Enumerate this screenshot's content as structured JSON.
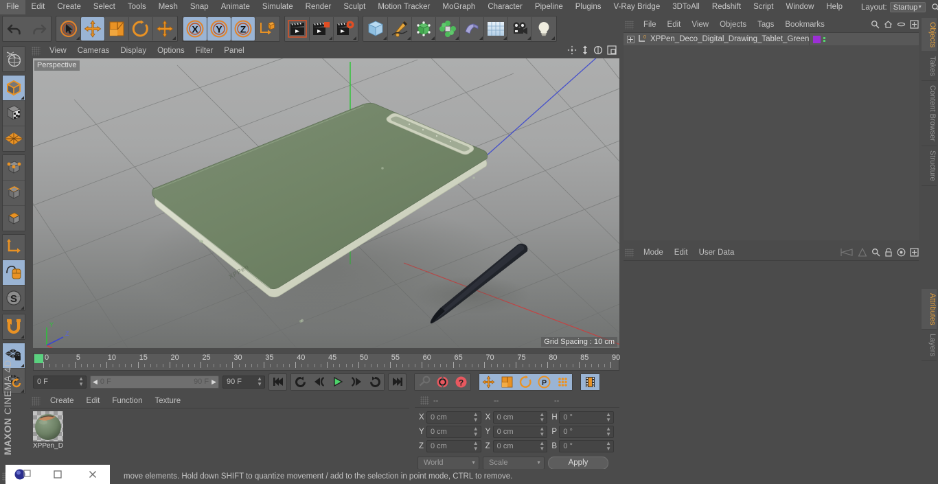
{
  "app": {
    "brand_maxon": "MAXON",
    "brand_c4d": "CINEMA 4D"
  },
  "menubar": {
    "items": [
      "File",
      "Edit",
      "Create",
      "Select",
      "Tools",
      "Mesh",
      "Snap",
      "Animate",
      "Simulate",
      "Render",
      "Sculpt",
      "Motion Tracker",
      "MoGraph",
      "Character",
      "Pipeline",
      "Plugins",
      "V-Ray Bridge",
      "3DToAll",
      "Redshift",
      "Script",
      "Window",
      "Help"
    ],
    "layout_label": "Layout:",
    "layout_value": "Startup"
  },
  "toolbar": {
    "undo": "undo-arrow",
    "redo": "redo-arrow",
    "live_select": "live-selection-tool",
    "move": "move-tool",
    "scale": "scale-tool",
    "rotate": "rotate-tool",
    "move2": "move-tool-2",
    "axis_x": "X",
    "axis_y": "Y",
    "axis_z": "Z",
    "world_object": "world-object-axis",
    "render_view": "render-view",
    "render_region": "render-region",
    "render_settings": "render-settings",
    "cube": "primitive-cube",
    "spline": "spline-pen",
    "nurbs": "subdivision-surface",
    "mograph": "mograph-cloner",
    "deformer": "bend-deformer",
    "scene": "floor-environment",
    "camera": "camera-object",
    "light": "light-object"
  },
  "lefttools": [
    {
      "name": "texture-axis-tool",
      "selected": false
    },
    {
      "name": "model-mode",
      "selected": true
    },
    {
      "name": "texture-mode",
      "selected": false
    },
    {
      "name": "polygon-grid-mode",
      "selected": false
    },
    {
      "name": "points-mode",
      "selected": false
    },
    {
      "name": "edges-mode",
      "selected": false
    },
    {
      "name": "polygons-mode",
      "selected": false
    },
    {
      "name": "object-axis-mode",
      "selected": false
    },
    {
      "name": "enable-axis-mode",
      "selected": true
    },
    {
      "name": "viewport-solo-mode",
      "selected": false
    },
    {
      "name": "enable-snapping",
      "selected": false
    },
    {
      "name": "lock-workplane",
      "selected": true
    },
    {
      "name": "workplane-mode",
      "selected": false
    }
  ],
  "viewport": {
    "menu": [
      "View",
      "Cameras",
      "Display",
      "Options",
      "Filter",
      "Panel"
    ],
    "label": "Perspective",
    "grid_spacing": "Grid Spacing : 10 cm",
    "axis_x": "X",
    "axis_y": "Y",
    "axis_z": "Z",
    "corner_icons": [
      "pan-icon",
      "dolly-icon",
      "rotate-view-icon",
      "maximize-viewport-icon"
    ],
    "colors": {
      "tablet_body": "#6f8268",
      "tablet_edge": "#d8dccb",
      "stylus": "#23262d",
      "axis_x": "#d84a4a",
      "axis_y": "#3fc64a",
      "axis_z": "#4a55d8",
      "bg_top": "#a9aaa9",
      "bg_bottom": "#6e706e"
    }
  },
  "timeline": {
    "ticks": [
      0,
      5,
      10,
      15,
      20,
      25,
      30,
      35,
      40,
      45,
      50,
      55,
      60,
      65,
      70,
      75,
      80,
      85,
      90
    ],
    "current_frame": "0 F",
    "range_start": "0 F",
    "range_end": "90 F",
    "max_frame": "90 F",
    "preview_end": "0 F",
    "buttons": [
      "go-to-start",
      "play-backwards-loop",
      "step-back",
      "play",
      "step-forward",
      "loop-toggle",
      "go-to-end"
    ],
    "record_buttons": [
      "autokey-toggle",
      "record-active-objects",
      "record-keyframe-help"
    ],
    "key_buttons": [
      "key-position",
      "key-scale",
      "key-rotation",
      "key-parameter",
      "key-points",
      "key-dopesheet"
    ]
  },
  "materials": {
    "menu": [
      "Create",
      "Edit",
      "Function",
      "Texture"
    ],
    "items": [
      {
        "name": "XPPen_D",
        "color": "#6f8268"
      }
    ]
  },
  "coordinates": {
    "header": [
      "--",
      "--",
      "--"
    ],
    "rows": [
      {
        "l1": "X",
        "v1": "0 cm",
        "l2": "X",
        "v2": "0 cm",
        "l3": "H",
        "v3": "0 °"
      },
      {
        "l1": "Y",
        "v1": "0 cm",
        "l2": "Y",
        "v2": "0 cm",
        "l3": "P",
        "v3": "0 °"
      },
      {
        "l1": "Z",
        "v1": "0 cm",
        "l2": "Z",
        "v2": "0 cm",
        "l3": "B",
        "v3": "0 °"
      }
    ],
    "space_dd": "World",
    "mode_dd": "Scale",
    "apply": "Apply"
  },
  "objects_panel": {
    "menu": [
      "File",
      "Edit",
      "View",
      "Objects",
      "Tags",
      "Bookmarks"
    ],
    "icons": [
      "search-icon",
      "home-icon",
      "ellipse-icon",
      "expand-icon"
    ],
    "row": {
      "label": "XPPen_Deco_Digital_Drawing_Tablet_Green",
      "layer_num": "0",
      "swatch": "#9c2fd6"
    }
  },
  "attributes_panel": {
    "menu": [
      "Mode",
      "Edit",
      "User Data"
    ],
    "icons": [
      "back-nav-icon",
      "forward-nav-icon",
      "search-icon",
      "lock-icon",
      "target-icon",
      "expand-icon"
    ]
  },
  "vtabs_top": [
    "Objects",
    "Takes",
    "Content Browser",
    "Structure"
  ],
  "vtabs_bottom": [
    "Attributes",
    "Layers"
  ],
  "status": {
    "message": "move elements. Hold down SHIFT to quantize movement / add to the selection in point mode, CTRL to remove."
  },
  "taskbar": {
    "icons": [
      "c4d-app-icon",
      "restore-icon",
      "close-icon"
    ]
  }
}
